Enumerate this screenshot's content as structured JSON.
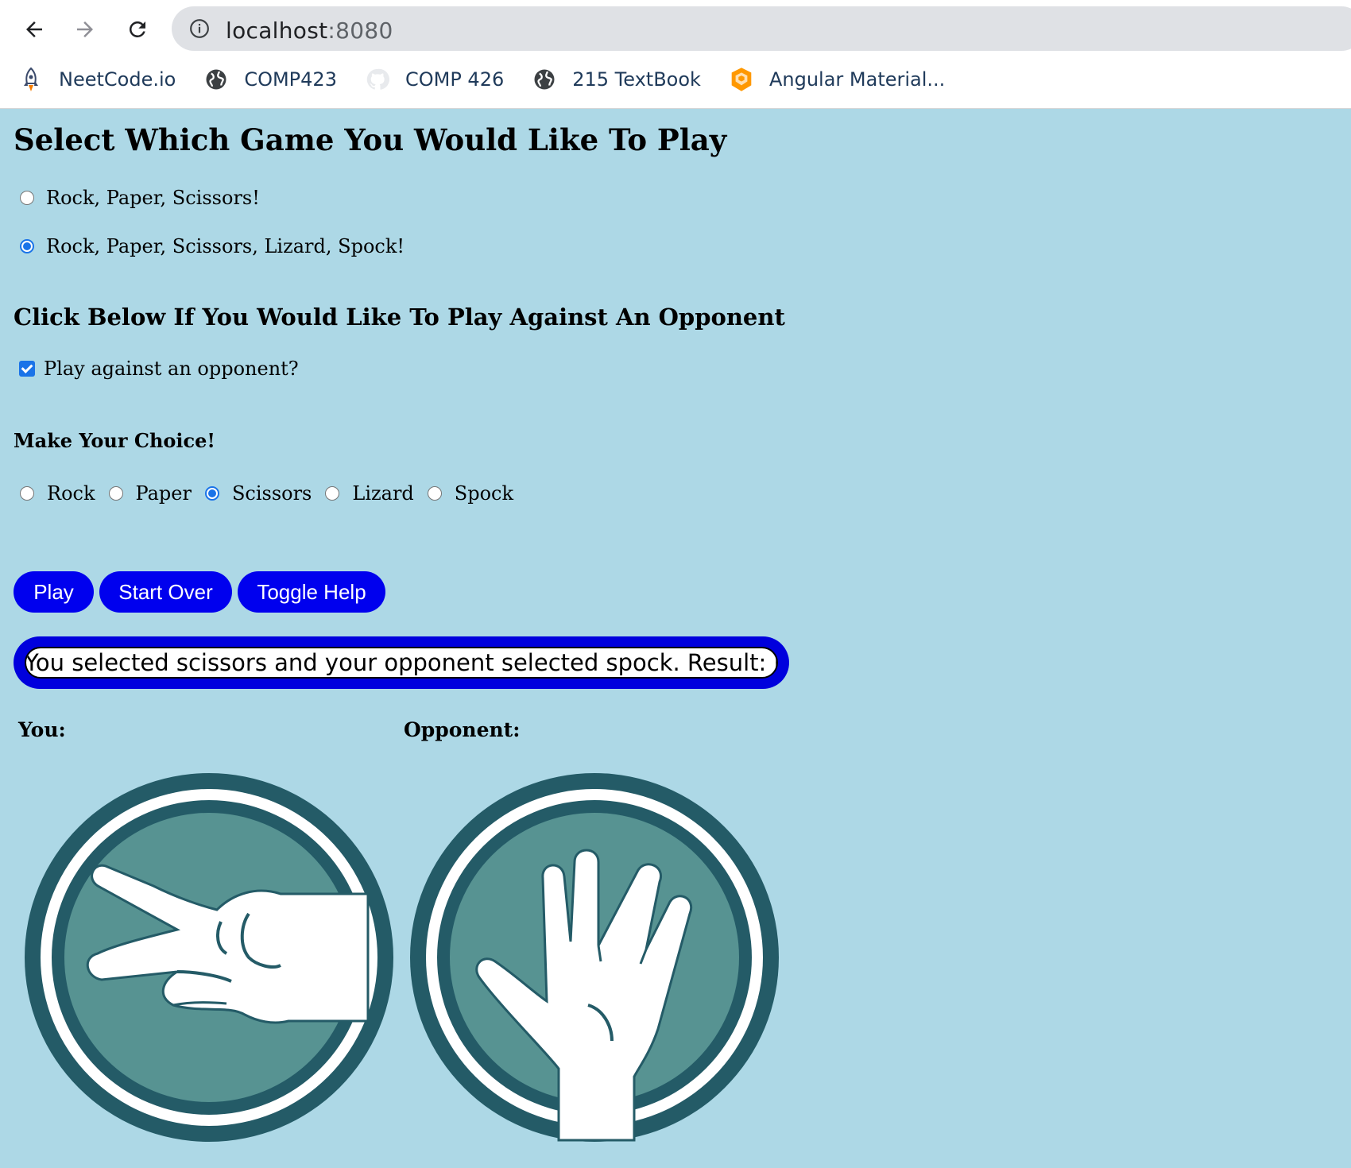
{
  "browser": {
    "url_host": "localhost",
    "url_port": ":8080",
    "bookmarks": [
      {
        "label": "NeetCode.io",
        "icon": "rocket-icon"
      },
      {
        "label": "COMP423",
        "icon": "globe-icon"
      },
      {
        "label": "COMP 426",
        "icon": "github-icon"
      },
      {
        "label": "215 TextBook",
        "icon": "globe-icon"
      },
      {
        "label": "Angular Material...",
        "icon": "angular-material-icon"
      }
    ]
  },
  "page": {
    "title": "Select Which Game You Would Like To Play",
    "game_options": [
      {
        "label": "Rock, Paper, Scissors!",
        "selected": false
      },
      {
        "label": "Rock, Paper, Scissors, Lizard, Spock!",
        "selected": true
      }
    ],
    "opponent_heading": "Click Below If You Would Like To Play Against An Opponent",
    "opponent_checkbox": {
      "label": "Play against an opponent?",
      "checked": true
    },
    "choice_heading": "Make Your Choice!",
    "choices": [
      {
        "label": "Rock",
        "selected": false
      },
      {
        "label": "Paper",
        "selected": false
      },
      {
        "label": "Scissors",
        "selected": true
      },
      {
        "label": "Lizard",
        "selected": false
      },
      {
        "label": "Spock",
        "selected": false
      }
    ],
    "buttons": {
      "play": "Play",
      "start_over": "Start Over",
      "toggle_help": "Toggle Help"
    },
    "result_text": "You selected scissors and your opponent selected spock. Result: lose",
    "you_label": "You:",
    "opponent_label": "Opponent:",
    "you_choice_icon": "scissors-hand-icon",
    "opponent_choice_icon": "spock-hand-icon"
  },
  "colors": {
    "page_bg": "#add8e6",
    "button_bg": "#0000ee",
    "icon_ring": "#245b67",
    "icon_fill": "#579392"
  }
}
